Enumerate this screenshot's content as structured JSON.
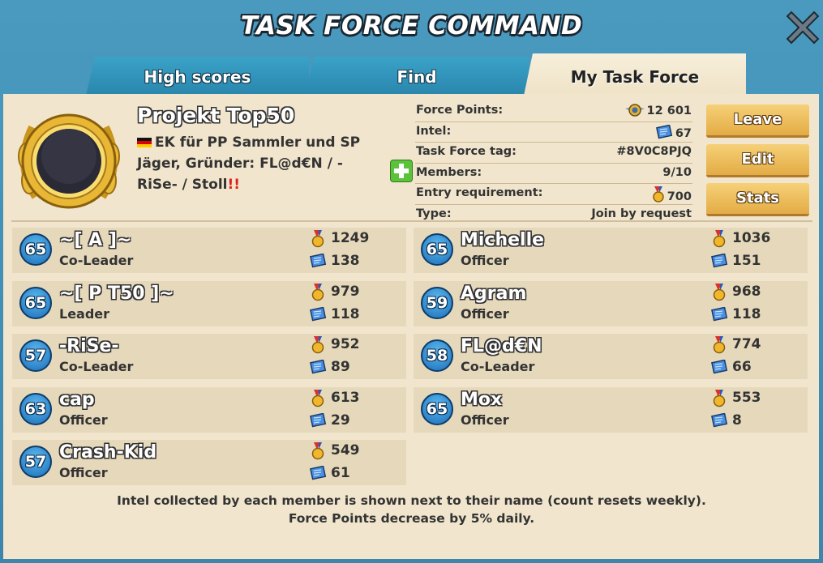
{
  "title": "TASK FORCE COMMAND",
  "tabs": [
    {
      "label": "High scores",
      "active": false
    },
    {
      "label": "Find",
      "active": false
    },
    {
      "label": "My Task Force",
      "active": true
    }
  ],
  "taskforce": {
    "name": "Projekt Top50",
    "description": "EK für PP Sammler und SP Jäger, Gründer: FL@d€N / -RiSe- / Stoll",
    "description_suffix": "!!",
    "force_points_label": "Force Points:",
    "force_points": "12 601",
    "intel_label": "Intel:",
    "intel": "67",
    "tag_label": "Task Force tag:",
    "tag": "#8V0C8PJQ",
    "members_label": "Members:",
    "members": "9/10",
    "entry_label": "Entry requirement:",
    "entry": "700",
    "type_label": "Type:",
    "type": "Join by request"
  },
  "buttons": {
    "leave": "Leave",
    "edit": "Edit",
    "stats": "Stats"
  },
  "members": [
    {
      "level": "65",
      "name": "~[ A ]~",
      "role": "Co-Leader",
      "medals": "1249",
      "intel": "138"
    },
    {
      "level": "65",
      "name": "Michelle",
      "role": "Officer",
      "medals": "1036",
      "intel": "151"
    },
    {
      "level": "65",
      "name": "~[ P T50 ]~",
      "role": "Leader",
      "medals": "979",
      "intel": "118"
    },
    {
      "level": "59",
      "name": "Agram",
      "role": "Officer",
      "medals": "968",
      "intel": "118"
    },
    {
      "level": "57",
      "name": "-RiSe-",
      "role": "Co-Leader",
      "medals": "952",
      "intel": "89"
    },
    {
      "level": "58",
      "name": "FL@d€N",
      "role": "Co-Leader",
      "medals": "774",
      "intel": "66"
    },
    {
      "level": "63",
      "name": "cap",
      "role": "Officer",
      "medals": "613",
      "intel": "29"
    },
    {
      "level": "65",
      "name": "Mox",
      "role": "Officer",
      "medals": "553",
      "intel": "8"
    },
    {
      "level": "57",
      "name": "Crash-Kid",
      "role": "Officer",
      "medals": "549",
      "intel": "61"
    }
  ],
  "footer": {
    "line1": "Intel collected by each member is shown next to their name (count resets weekly).",
    "line2": "Force Points decrease by 5% daily."
  },
  "icons": {
    "close": "close-icon",
    "force_points": "force-points-icon",
    "intel": "intel-icon",
    "medal": "medal-icon",
    "add": "add-member-icon",
    "emblem": "laurel-emblem-icon"
  },
  "colors": {
    "accent": "#e3ac45",
    "panel": "#f1e6cd",
    "level_badge": "#1d6fb8"
  }
}
